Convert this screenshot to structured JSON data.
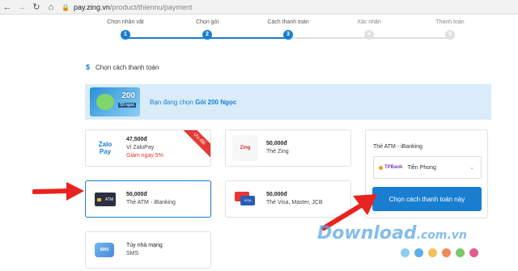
{
  "browser": {
    "back_icon": "arrow-left-icon",
    "forward_icon": "arrow-right-icon",
    "reload_icon": "reload-icon",
    "home_icon": "home-icon",
    "url_host": "pay.zing.vn",
    "url_path": "/product/thiennu/payment"
  },
  "stepper": {
    "steps": [
      {
        "label": "Chọn nhân vật",
        "number": "1",
        "state": "active"
      },
      {
        "label": "Chọn gói",
        "number": "2",
        "state": "active"
      },
      {
        "label": "Cách thanh toán",
        "number": "3",
        "state": "active"
      },
      {
        "label": "Xác nhận",
        "number": "4",
        "state": "inactive"
      },
      {
        "label": "Thanh toán",
        "number": "5",
        "state": "inactive"
      }
    ]
  },
  "section": {
    "icon": "$",
    "title": "Chọn cách thanh toán"
  },
  "banner": {
    "card_value": "200",
    "card_tag": "50 ngọc",
    "text_prefix": "Bạn đang chọn",
    "package": "Gói 200 Ngọc"
  },
  "options": {
    "zalopay": {
      "logo_top": "Zalo",
      "logo_bottom": "Pay",
      "amount": "47,500đ",
      "name": "Ví ZaloPay",
      "promo": "Giảm ngay 5%",
      "ribbon": "Ưu đãi"
    },
    "zing": {
      "logo": "Zing",
      "amount": "50,000đ",
      "name": "Thẻ Zing"
    },
    "atm": {
      "logo": "ATM",
      "amount": "50,000đ",
      "name": "Thẻ ATM - iBanking"
    },
    "visa": {
      "logo": "VISA",
      "amount": "50,000đ",
      "name": "Thẻ Visa, Master, JCB"
    },
    "sms": {
      "logo": "SMS",
      "amount": "Tùy nhà mạng",
      "name": "SMS"
    }
  },
  "panel": {
    "title": "Thẻ ATM - iBanking",
    "bank_logo": "TPBank",
    "bank_name": "Tiền Phong",
    "submit_label": "Chọn cách thanh toán này"
  },
  "watermark": {
    "text": "Download",
    "suffix": ".com.vn",
    "dot_colors": [
      "#8ccdf0",
      "#5fb0e8",
      "#f0c05a",
      "#f08a5a",
      "#7ac86a",
      "#e05a8a"
    ]
  },
  "colors": {
    "accent": "#1a7ed0",
    "arrow": "#e8231f",
    "promo": "#e03030"
  }
}
